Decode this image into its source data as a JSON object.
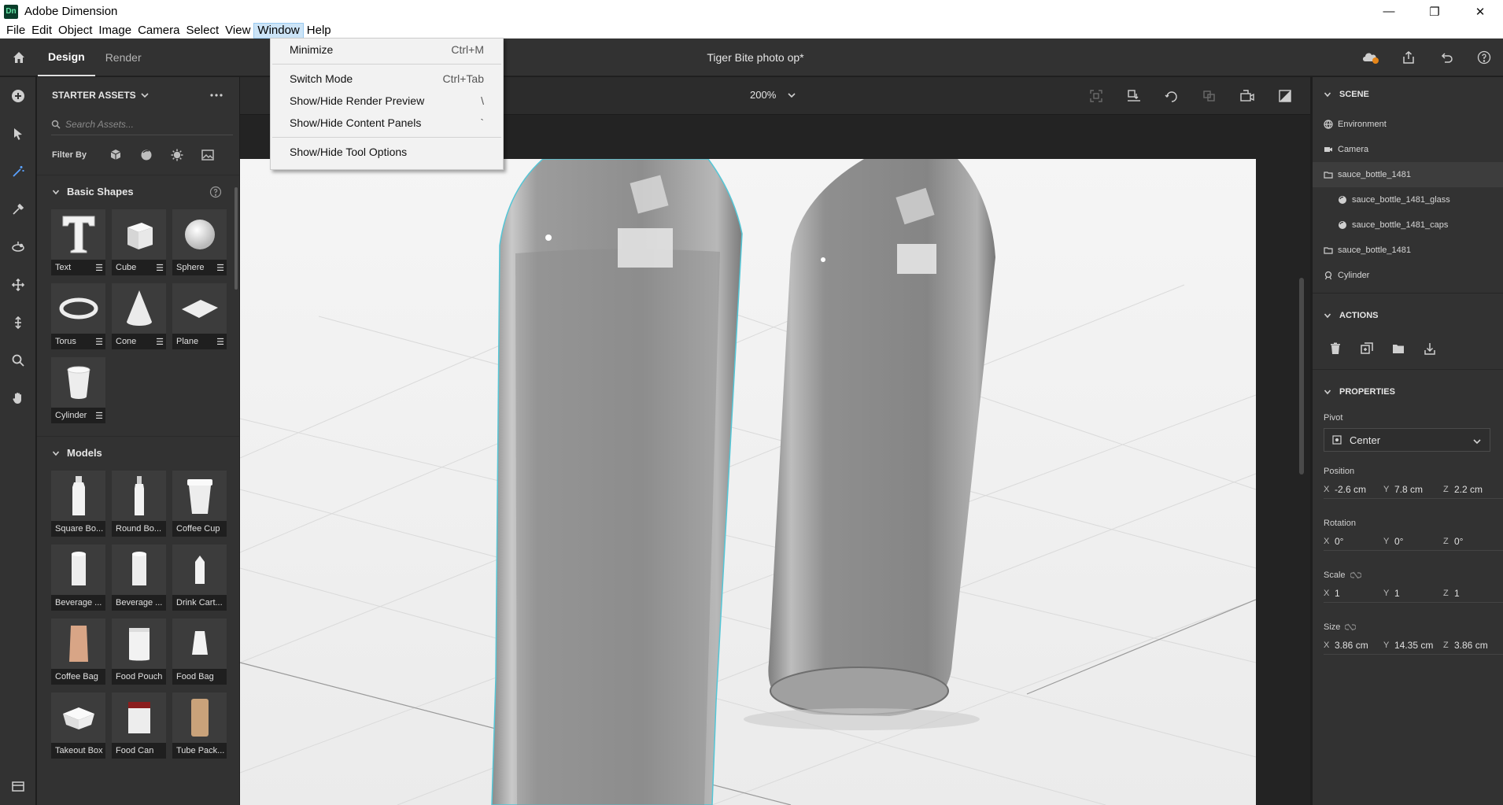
{
  "window": {
    "title": "Adobe Dimension",
    "logo": "Dn",
    "minimize": "—",
    "maximize": "❐",
    "close": "✕"
  },
  "menu": [
    "File",
    "Edit",
    "Object",
    "Image",
    "Camera",
    "Select",
    "View",
    "Window",
    "Help"
  ],
  "open_menu": "Window",
  "window_menu": [
    {
      "label": "Minimize",
      "shortcut": "Ctrl+M"
    },
    {
      "label": "Switch Mode",
      "shortcut": "Ctrl+Tab"
    },
    {
      "label": "Show/Hide Render Preview",
      "shortcut": "\\"
    },
    {
      "label": "Show/Hide Content Panels",
      "shortcut": "`"
    },
    {
      "label": "Show/Hide Tool Options",
      "shortcut": ""
    }
  ],
  "appbar": {
    "tabs": [
      "Design",
      "Render"
    ],
    "active_tab": "Design",
    "document_title": "Tiger Bite photo op*"
  },
  "assets": {
    "header": "STARTER ASSETS",
    "search_placeholder": "Search Assets...",
    "filter_label": "Filter By",
    "basic_shapes_title": "Basic Shapes",
    "basic_shapes": [
      "Text",
      "Cube",
      "Sphere",
      "Torus",
      "Cone",
      "Plane",
      "Cylinder"
    ],
    "models_title": "Models",
    "models": [
      "Square Bo...",
      "Round Bo...",
      "Coffee Cup",
      "Beverage ...",
      "Beverage ...",
      "Drink Cart...",
      "Coffee Bag",
      "Food Pouch",
      "Food Bag",
      "Takeout Box",
      "Food Can",
      "Tube Pack..."
    ]
  },
  "viewport": {
    "zoom": "200%"
  },
  "scene": {
    "title": "SCENE",
    "items": [
      {
        "label": "Environment",
        "icon": "environment-icon"
      },
      {
        "label": "Camera",
        "icon": "camera-icon"
      },
      {
        "label": "sauce_bottle_1481",
        "icon": "folder-icon"
      },
      {
        "label": "sauce_bottle_1481_glass",
        "icon": "material-icon"
      },
      {
        "label": "sauce_bottle_1481_caps",
        "icon": "material-icon"
      },
      {
        "label": "sauce_bottle_1481",
        "icon": "folder-icon"
      },
      {
        "label": "Cylinder",
        "icon": "object-icon"
      }
    ]
  },
  "actions": {
    "title": "ACTIONS"
  },
  "properties": {
    "title": "PROPERTIES",
    "pivot_label": "Pivot",
    "pivot_value": "Center",
    "position_label": "Position",
    "position": {
      "x": "-2.6 cm",
      "y": "7.8 cm",
      "z": "2.2 cm"
    },
    "rotation_label": "Rotation",
    "rotation": {
      "x": "0°",
      "y": "0°",
      "z": "0°"
    },
    "scale_label": "Scale",
    "scale": {
      "x": "1",
      "y": "1",
      "z": "1"
    },
    "size_label": "Size",
    "size": {
      "x": "3.86 cm",
      "y": "14.35 cm",
      "z": "3.86 cm"
    },
    "axes": {
      "x": "X",
      "y": "Y",
      "z": "Z"
    }
  }
}
